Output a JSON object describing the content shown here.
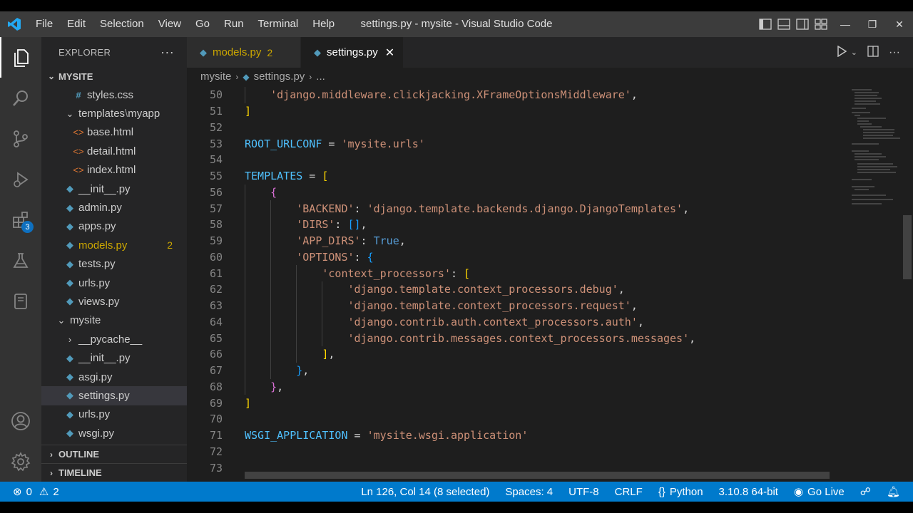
{
  "window": {
    "title": "settings.py - mysite - Visual Studio Code",
    "menu": [
      "File",
      "Edit",
      "Selection",
      "View",
      "Go",
      "Run",
      "Terminal",
      "Help"
    ]
  },
  "activity": {
    "extensions_badge": "3"
  },
  "sidebar": {
    "header": "EXPLORER",
    "more": "···",
    "root": "MYSITE",
    "items": [
      {
        "label": "styles.css",
        "icon": "css-hash-icon",
        "depth": 2,
        "kind": "file"
      },
      {
        "label": "templates",
        "label2": "myapp",
        "icon": "chevron-down-icon",
        "depth": 1,
        "kind": "folder"
      },
      {
        "label": "base.html",
        "icon": "html-icon",
        "depth": 2,
        "kind": "file"
      },
      {
        "label": "detail.html",
        "icon": "html-icon",
        "depth": 2,
        "kind": "file"
      },
      {
        "label": "index.html",
        "icon": "html-icon",
        "depth": 2,
        "kind": "file"
      },
      {
        "label": "__init__.py",
        "icon": "python-icon",
        "depth": 1,
        "kind": "file"
      },
      {
        "label": "admin.py",
        "icon": "python-icon",
        "depth": 1,
        "kind": "file"
      },
      {
        "label": "apps.py",
        "icon": "python-icon",
        "depth": 1,
        "kind": "file"
      },
      {
        "label": "models.py",
        "icon": "python-icon",
        "depth": 1,
        "kind": "file",
        "badge": "2"
      },
      {
        "label": "tests.py",
        "icon": "python-icon",
        "depth": 1,
        "kind": "file"
      },
      {
        "label": "urls.py",
        "icon": "python-icon",
        "depth": 1,
        "kind": "file"
      },
      {
        "label": "views.py",
        "icon": "python-icon",
        "depth": 1,
        "kind": "file"
      },
      {
        "label": "mysite",
        "icon": "chevron-down-icon",
        "depth": 0,
        "kind": "folder"
      },
      {
        "label": "__pycache__",
        "icon": "chevron-right-icon",
        "depth": 1,
        "kind": "folder"
      },
      {
        "label": "__init__.py",
        "icon": "python-icon",
        "depth": 1,
        "kind": "file"
      },
      {
        "label": "asgi.py",
        "icon": "python-icon",
        "depth": 1,
        "kind": "file"
      },
      {
        "label": "settings.py",
        "icon": "python-icon",
        "depth": 1,
        "kind": "file",
        "selected": true
      },
      {
        "label": "urls.py",
        "icon": "python-icon",
        "depth": 1,
        "kind": "file"
      },
      {
        "label": "wsgi.py",
        "icon": "python-icon",
        "depth": 1,
        "kind": "file"
      }
    ],
    "outline": "OUTLINE",
    "timeline": "TIMELINE"
  },
  "tabs": [
    {
      "label": "models.py",
      "badge": "2"
    },
    {
      "label": "settings.py",
      "close": "✕"
    }
  ],
  "breadcrumb": [
    "mysite",
    "settings.py",
    "..."
  ],
  "code": {
    "lines": [
      {
        "n": "50",
        "indent": 1,
        "tokens": [
          [
            "str",
            "'django.middleware.clickjacking.XFrameOptionsMiddleware'"
          ],
          [
            "punc",
            ","
          ]
        ]
      },
      {
        "n": "51",
        "indent": 0,
        "tokens": [
          [
            "br1",
            "]"
          ]
        ]
      },
      {
        "n": "52",
        "indent": 0,
        "tokens": []
      },
      {
        "n": "53",
        "indent": 0,
        "tokens": [
          [
            "var",
            "ROOT_URLCONF"
          ],
          [
            "punc",
            " = "
          ],
          [
            "str",
            "'mysite.urls'"
          ]
        ]
      },
      {
        "n": "54",
        "indent": 0,
        "tokens": []
      },
      {
        "n": "55",
        "indent": 0,
        "tokens": [
          [
            "var",
            "TEMPLATES"
          ],
          [
            "punc",
            " = "
          ],
          [
            "br1",
            "["
          ]
        ]
      },
      {
        "n": "56",
        "indent": 1,
        "tokens": [
          [
            "br2",
            "{"
          ]
        ]
      },
      {
        "n": "57",
        "indent": 2,
        "tokens": [
          [
            "str",
            "'BACKEND'"
          ],
          [
            "punc",
            ": "
          ],
          [
            "str",
            "'django.template.backends.django.DjangoTemplates'"
          ],
          [
            "punc",
            ","
          ]
        ]
      },
      {
        "n": "58",
        "indent": 2,
        "tokens": [
          [
            "str",
            "'DIRS'"
          ],
          [
            "punc",
            ": "
          ],
          [
            "br3",
            "[]"
          ],
          [
            "punc",
            ","
          ]
        ]
      },
      {
        "n": "59",
        "indent": 2,
        "tokens": [
          [
            "str",
            "'APP_DIRS'"
          ],
          [
            "punc",
            ": "
          ],
          [
            "kw",
            "True"
          ],
          [
            "punc",
            ","
          ]
        ]
      },
      {
        "n": "60",
        "indent": 2,
        "tokens": [
          [
            "str",
            "'OPTIONS'"
          ],
          [
            "punc",
            ": "
          ],
          [
            "br3",
            "{"
          ]
        ]
      },
      {
        "n": "61",
        "indent": 3,
        "tokens": [
          [
            "str",
            "'context_processors'"
          ],
          [
            "punc",
            ": "
          ],
          [
            "br1",
            "["
          ]
        ]
      },
      {
        "n": "62",
        "indent": 4,
        "tokens": [
          [
            "str",
            "'django.template.context_processors.debug'"
          ],
          [
            "punc",
            ","
          ]
        ]
      },
      {
        "n": "63",
        "indent": 4,
        "tokens": [
          [
            "str",
            "'django.template.context_processors.request'"
          ],
          [
            "punc",
            ","
          ]
        ]
      },
      {
        "n": "64",
        "indent": 4,
        "tokens": [
          [
            "str",
            "'django.contrib.auth.context_processors.auth'"
          ],
          [
            "punc",
            ","
          ]
        ]
      },
      {
        "n": "65",
        "indent": 4,
        "tokens": [
          [
            "str",
            "'django.contrib.messages.context_processors.messages'"
          ],
          [
            "punc",
            ","
          ]
        ]
      },
      {
        "n": "66",
        "indent": 3,
        "tokens": [
          [
            "br1",
            "]"
          ],
          [
            "punc",
            ","
          ]
        ]
      },
      {
        "n": "67",
        "indent": 2,
        "tokens": [
          [
            "br3",
            "}"
          ],
          [
            "punc",
            ","
          ]
        ]
      },
      {
        "n": "68",
        "indent": 1,
        "tokens": [
          [
            "br2",
            "}"
          ],
          [
            "punc",
            ","
          ]
        ]
      },
      {
        "n": "69",
        "indent": 0,
        "tokens": [
          [
            "br1",
            "]"
          ]
        ]
      },
      {
        "n": "70",
        "indent": 0,
        "tokens": []
      },
      {
        "n": "71",
        "indent": 0,
        "tokens": [
          [
            "var",
            "WSGI_APPLICATION"
          ],
          [
            "punc",
            " = "
          ],
          [
            "str",
            "'mysite.wsgi.application'"
          ]
        ]
      },
      {
        "n": "72",
        "indent": 0,
        "tokens": []
      },
      {
        "n": "73",
        "indent": 0,
        "tokens": []
      }
    ]
  },
  "status": {
    "errors": "0",
    "warnings": "2",
    "position": "Ln 126, Col 14 (8 selected)",
    "spaces": "Spaces: 4",
    "encoding": "UTF-8",
    "eol": "CRLF",
    "language": "Python",
    "interpreter": "3.10.8 64-bit",
    "golive": "Go Live"
  },
  "colors": {
    "accent": "#007acc",
    "warning": "#cca700",
    "string": "#ce9178",
    "variable": "#4fc1ff"
  }
}
